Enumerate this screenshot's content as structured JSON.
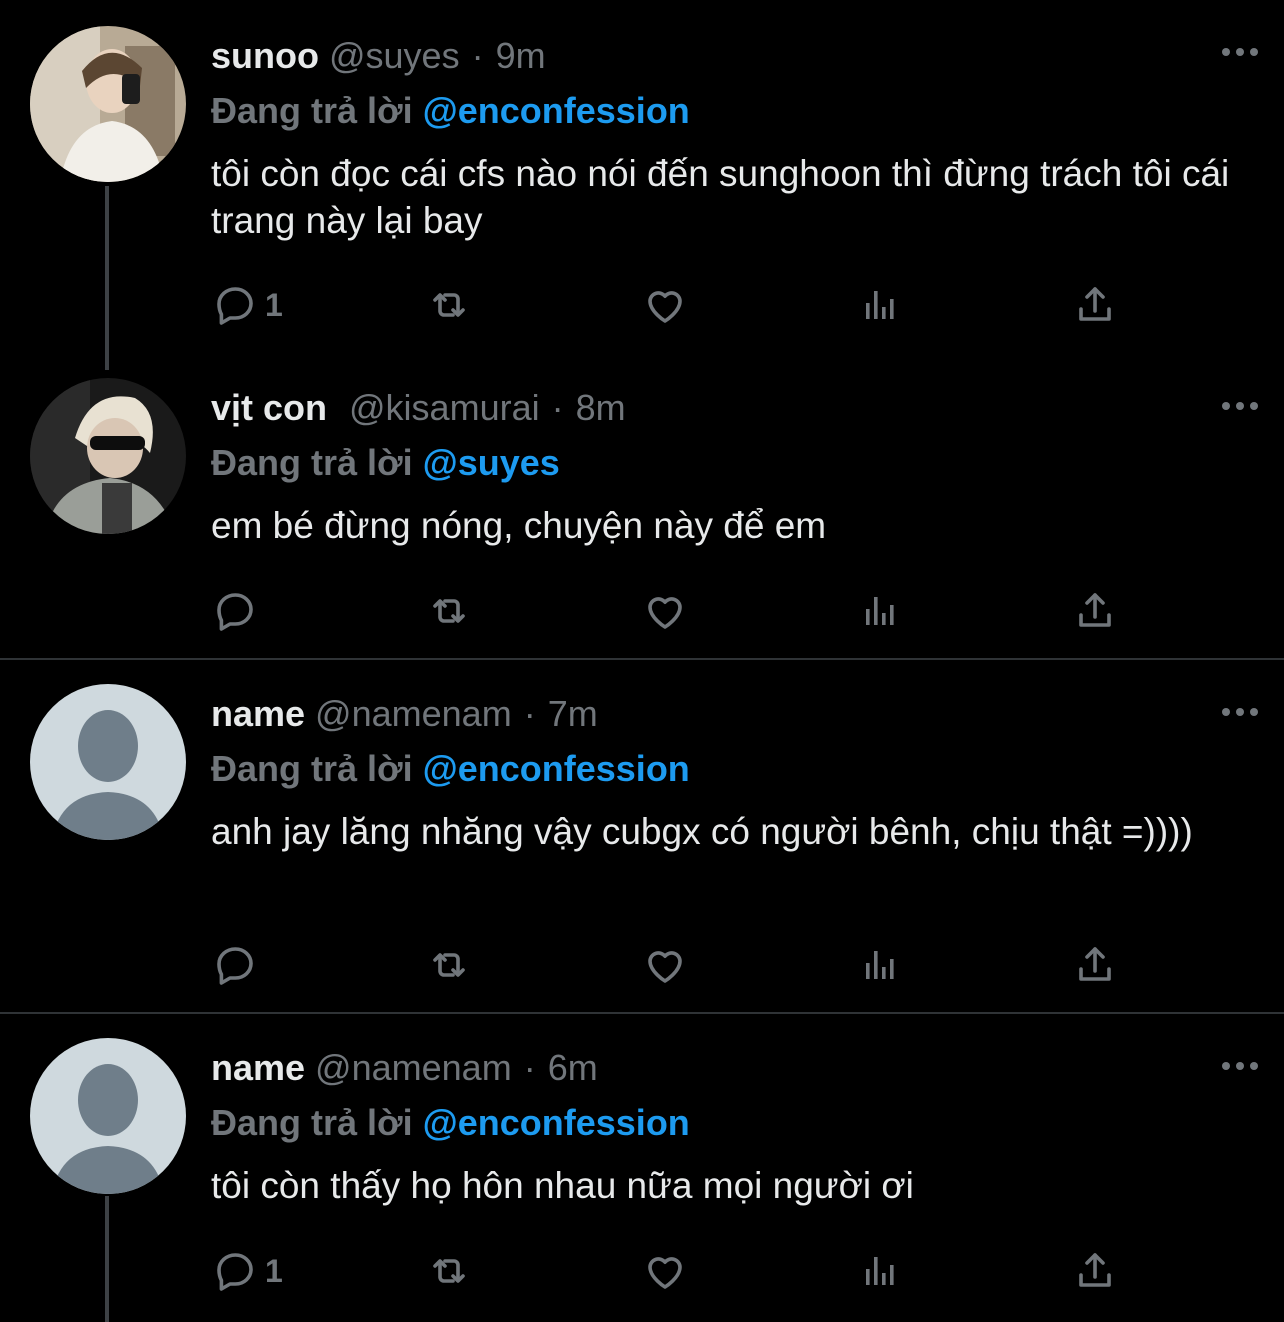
{
  "tweets": [
    {
      "name": "sunoo",
      "handle": "@suyes",
      "time": "9m",
      "replying_prefix": "Đang trả lời",
      "replying_to": "@enconfession",
      "text": "tôi còn đọc cái cfs nào nói đến sunghoon thì đừng trách tôi cái trang này lại bay",
      "reply_count": "1"
    },
    {
      "name": "vịt con",
      "handle": "@kisamurai",
      "time": "8m",
      "replying_prefix": "Đang trả lời",
      "replying_to": "@suyes",
      "text": "em bé đừng nóng, chuyện này để em",
      "reply_count": ""
    },
    {
      "name": "name",
      "handle": "@namenam",
      "time": "7m",
      "replying_prefix": "Đang trả lời",
      "replying_to": "@enconfession",
      "text": "anh jay lăng nhăng vậy cubgx có người bênh, chịu thật =))))",
      "reply_count": ""
    },
    {
      "name": "name",
      "handle": "@namenam",
      "time": "6m",
      "replying_prefix": "Đang trả lời",
      "replying_to": "@enconfession",
      "text": "tôi còn thấy họ hôn nhau nữa mọi người ơi",
      "reply_count": "1"
    }
  ],
  "dot_separator": "·",
  "icons": {
    "reply": "reply-icon",
    "retweet": "retweet-icon",
    "like": "heart-icon",
    "views": "views-icon",
    "share": "share-icon",
    "more": "more-dots-icon"
  },
  "colors": {
    "background": "#000000",
    "text": "#e7e9ea",
    "muted": "#71767b",
    "mention": "#1d9bf0",
    "divider": "#2f3336"
  }
}
